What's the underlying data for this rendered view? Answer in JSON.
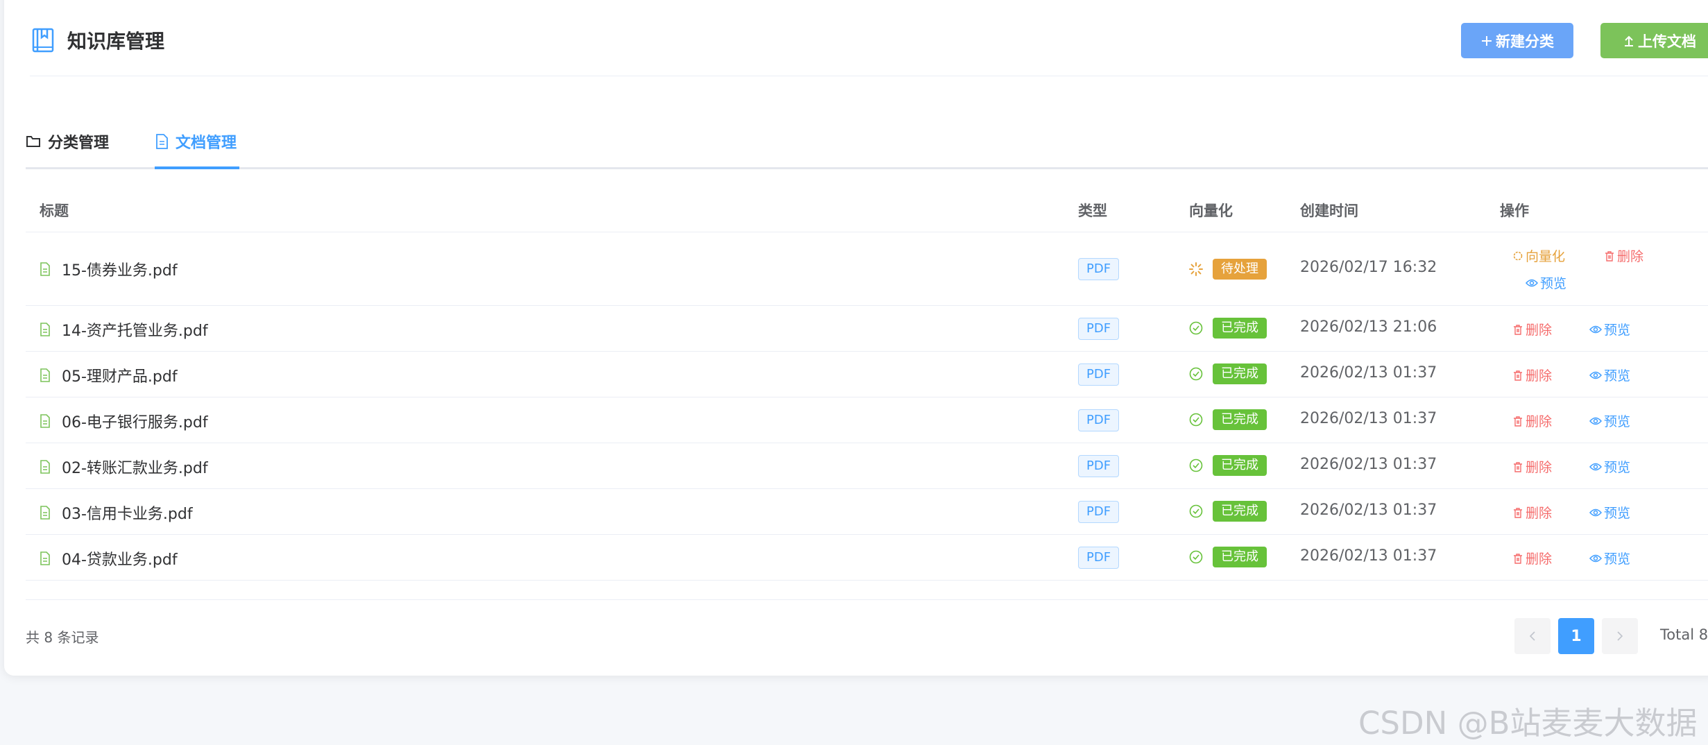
{
  "header": {
    "title": "知识库管理",
    "new_category": "新建分类",
    "upload_doc": "上传文档"
  },
  "tabs": [
    {
      "label": "分类管理",
      "active": false
    },
    {
      "label": "文档管理",
      "active": true
    }
  ],
  "table": {
    "columns": [
      "标题",
      "类型",
      "向量化",
      "创建时间",
      "操作"
    ],
    "rows": [
      {
        "title": "15-债券业务.pdf",
        "type": "PDF",
        "status": "待处理",
        "time": "2026/02/17 16:32"
      },
      {
        "title": "14-资产托管业务.pdf",
        "type": "PDF",
        "status": "已完成",
        "time": "2026/02/13 21:06"
      },
      {
        "title": "05-理财产品.pdf",
        "type": "PDF",
        "status": "已完成",
        "time": "2026/02/13 01:37"
      },
      {
        "title": "06-电子银行服务.pdf",
        "type": "PDF",
        "status": "已完成",
        "time": "2026/02/13 01:37"
      },
      {
        "title": "02-转账汇款业务.pdf",
        "type": "PDF",
        "status": "已完成",
        "time": "2026/02/13 01:37"
      },
      {
        "title": "03-信用卡业务.pdf",
        "type": "PDF",
        "status": "已完成",
        "time": "2026/02/13 01:37"
      },
      {
        "title": "04-贷款业务.pdf",
        "type": "PDF",
        "status": "已完成",
        "time": "2026/02/13 01:37"
      }
    ],
    "actions": {
      "vectorize": "向量化",
      "delete": "删除",
      "preview": "预览"
    }
  },
  "footer": {
    "records": "共 8 条记录",
    "page": "1",
    "total": "Total 8"
  },
  "watermark": "CSDN @B站麦麦大数据",
  "colors": {
    "primary": "#409eff",
    "success": "#67c23a",
    "warning": "#e6a23c",
    "danger": "#f56c6c"
  }
}
